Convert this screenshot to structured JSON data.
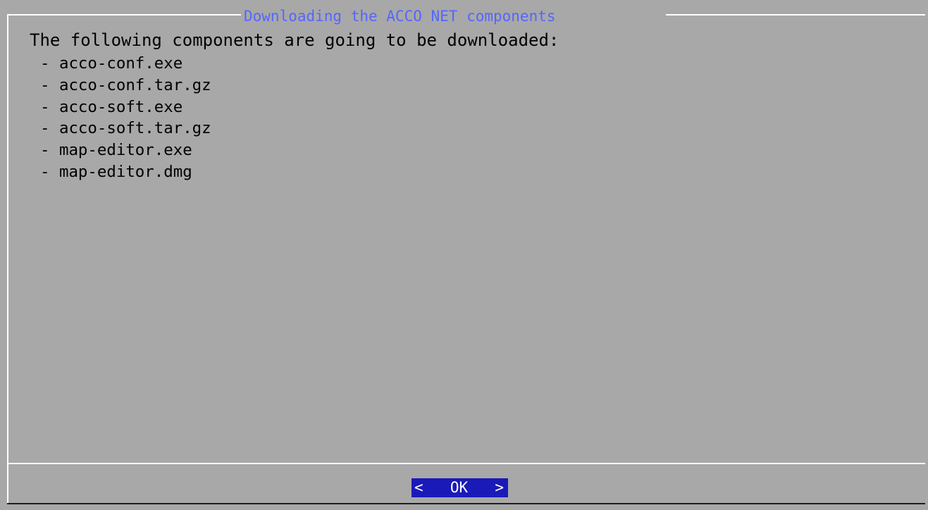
{
  "dialog": {
    "title": "Downloading the ACCO NET components",
    "message": "The following components are going to be downloaded:",
    "components": [
      "- acco-conf.exe",
      "- acco-conf.tar.gz",
      "- acco-soft.exe",
      "- acco-soft.tar.gz",
      "- map-editor.exe",
      "- map-editor.dmg"
    ],
    "ok_button": {
      "left_bracket": "<",
      "label": "OK",
      "right_bracket": ">"
    }
  },
  "colors": {
    "background": "#a8a8a8",
    "title": "#5466ff",
    "text": "#000000",
    "border_light": "#ffffff",
    "border_dark": "#1e1e1e",
    "button_bg": "#1a1ab8",
    "button_text": "#ffffff"
  }
}
